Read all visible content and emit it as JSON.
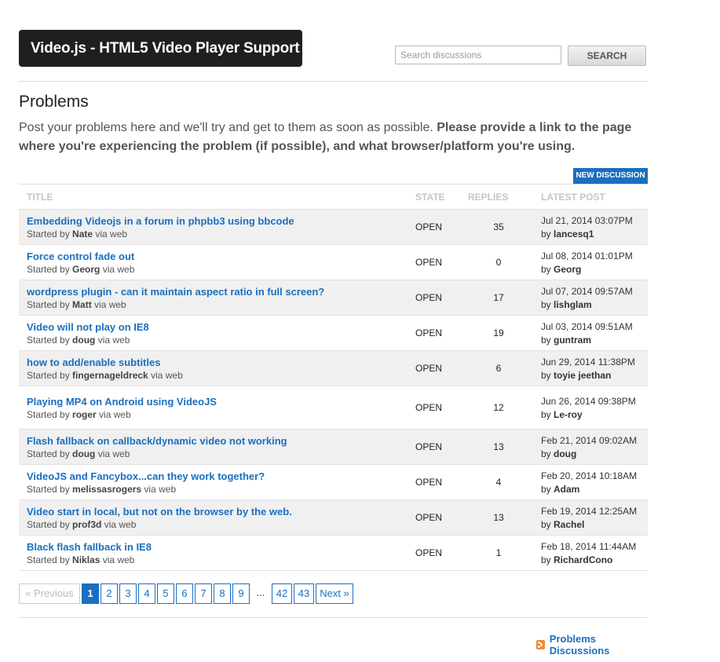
{
  "header": {
    "brand": "Video.js - HTML5 Video Player Support",
    "search_placeholder": "Search discussions",
    "search_button": "SEARCH"
  },
  "page": {
    "title": "Problems",
    "description_plain": "Post your problems here and we'll try and get to them as soon as possible. ",
    "description_bold": "Please provide a link to the page where you're experiencing the problem (if possible), and what browser/platform you're using.",
    "new_discussion": "NEW DISCUSSION"
  },
  "table": {
    "headers": {
      "title": "TITLE",
      "state": "STATE",
      "replies": "REPLIES",
      "latest": "LATEST POST"
    },
    "rows": [
      {
        "title": "Embedding Videojs in a forum in phpbb3 using bbcode",
        "started_prefix": "Started by ",
        "starter": "Nate",
        "via": " via web",
        "state": "OPEN",
        "replies": "35",
        "date": "Jul 21, 2014 03:07PM",
        "by_prefix": "by ",
        "by": "lancesq1"
      },
      {
        "title": "Force control fade out",
        "started_prefix": "Started by ",
        "starter": "Georg",
        "via": " via web",
        "state": "OPEN",
        "replies": "0",
        "date": "Jul 08, 2014 01:01PM",
        "by_prefix": "by ",
        "by": "Georg"
      },
      {
        "title": "wordpress plugin - can it maintain aspect ratio in full screen?",
        "started_prefix": "Started by ",
        "starter": "Matt",
        "via": " via web",
        "state": "OPEN",
        "replies": "17",
        "date": "Jul 07, 2014 09:57AM",
        "by_prefix": "by ",
        "by": "lishglam"
      },
      {
        "title": "Video will not play on IE8",
        "started_prefix": "Started by ",
        "starter": "doug",
        "via": " via web",
        "state": "OPEN",
        "replies": "19",
        "date": "Jul 03, 2014 09:51AM",
        "by_prefix": "by ",
        "by": "guntram"
      },
      {
        "title": "how to add/enable subtitles",
        "started_prefix": "Started by ",
        "starter": "fingernageldreck",
        "via": " via web",
        "state": "OPEN",
        "replies": "6",
        "date": "Jun 29, 2014 11:38PM",
        "by_prefix": "by ",
        "by": "toyie jeethan"
      },
      {
        "title": "Playing MP4 on Android using VideoJS",
        "started_prefix": "Started by ",
        "starter": "roger",
        "via": " via web",
        "state": "OPEN",
        "replies": "12",
        "date": "Jun 26, 2014 09:38PM",
        "by_prefix": "by ",
        "by": "Le-roy"
      },
      {
        "title": "Flash fallback on callback/dynamic video not working",
        "started_prefix": "Started by ",
        "starter": "doug",
        "via": " via web",
        "state": "OPEN",
        "replies": "13",
        "date": "Feb 21, 2014 09:02AM",
        "by_prefix": "by ",
        "by": "doug"
      },
      {
        "title": "VideoJS and Fancybox...can they work together?",
        "started_prefix": "Started by ",
        "starter": "melissasrogers",
        "via": " via web",
        "state": "OPEN",
        "replies": "4",
        "date": "Feb 20, 2014 10:18AM",
        "by_prefix": "by ",
        "by": "Adam"
      },
      {
        "title": "Video start in local, but not on the browser by the web.",
        "started_prefix": "Started by ",
        "starter": "prof3d",
        "via": " via web",
        "state": "OPEN",
        "replies": "13",
        "date": "Feb 19, 2014 12:25AM",
        "by_prefix": "by ",
        "by": "Rachel"
      },
      {
        "title": "Black flash fallback in IE8",
        "started_prefix": "Started by ",
        "starter": "Niklas",
        "via": " via web",
        "state": "OPEN",
        "replies": "1",
        "date": "Feb 18, 2014 11:44AM",
        "by_prefix": "by ",
        "by": "RichardCono"
      }
    ]
  },
  "pagination": {
    "previous": "« Previous",
    "pages": [
      "1",
      "2",
      "3",
      "4",
      "5",
      "6",
      "7",
      "8",
      "9"
    ],
    "ellipsis": "...",
    "tail_pages": [
      "42",
      "43"
    ],
    "next": "Next »",
    "current_page": "1"
  },
  "footer": {
    "feed_icon": "rss-icon",
    "feed_label": "Problems Discussions"
  },
  "colors": {
    "accent": "#1a6fc0",
    "brand_bg": "#1f1f1f",
    "row_alt": "#f0f0f0",
    "rss": "#f18a33"
  }
}
